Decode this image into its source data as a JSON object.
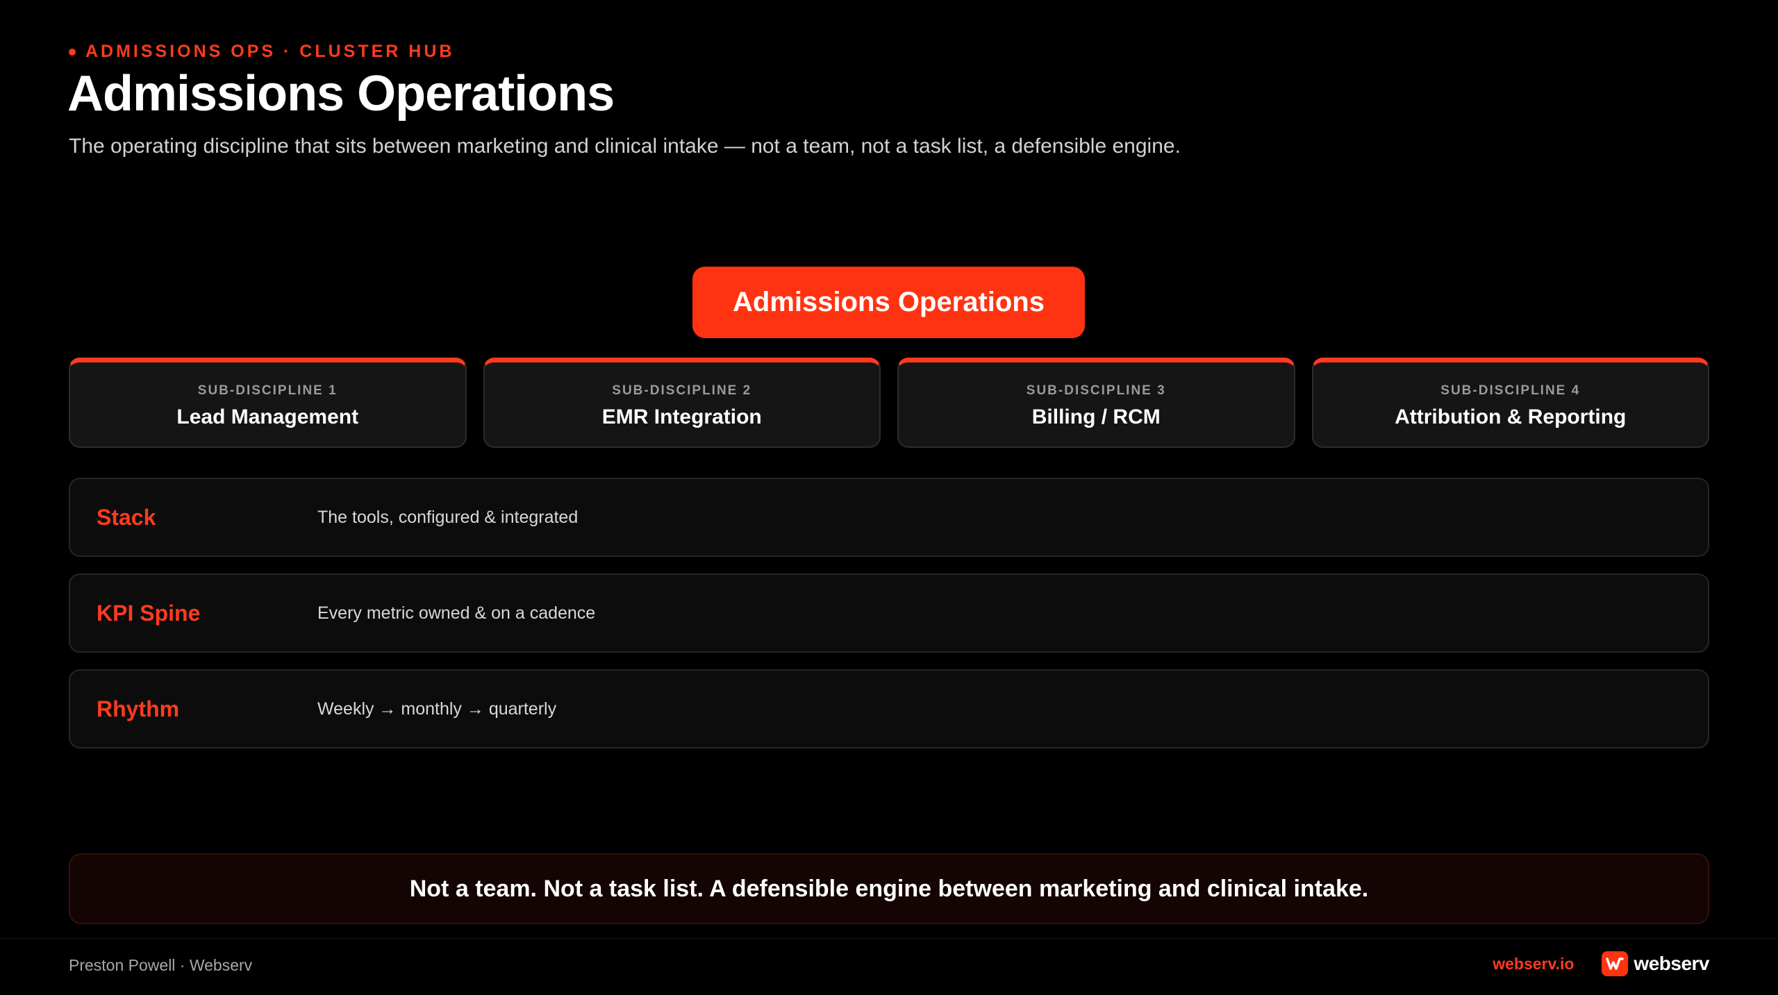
{
  "header": {
    "eyebrow": "ADMISSIONS OPS · CLUSTER HUB",
    "title": "Admissions Operations",
    "subtitle": "The operating discipline that sits between marketing and clinical intake — not a team, not a task list, a defensible engine."
  },
  "diagram": {
    "root": "Admissions Operations",
    "sub_disciplines": [
      {
        "kicker": "SUB-DISCIPLINE 1",
        "name": "Lead Management"
      },
      {
        "kicker": "SUB-DISCIPLINE 2",
        "name": "EMR Integration"
      },
      {
        "kicker": "SUB-DISCIPLINE 3",
        "name": "Billing / RCM"
      },
      {
        "kicker": "SUB-DISCIPLINE 4",
        "name": "Attribution & Reporting"
      }
    ],
    "layers": [
      {
        "label": "Stack",
        "description": "The tools, configured & integrated"
      },
      {
        "label": "KPI Spine",
        "description": "Every metric owned & on a cadence"
      },
      {
        "label": "Rhythm",
        "description": "Weekly → monthly → quarterly"
      }
    ]
  },
  "callout": "Not a team. Not a task list. A defensible engine between marketing and clinical intake.",
  "footer": {
    "author": "Preston Powell · Webserv",
    "link": "webserv.io",
    "brand": "webserv"
  },
  "colors": {
    "accent": "#ff3311",
    "background": "#000000",
    "card": "#151515"
  },
  "icons": {
    "eyebrow_marker": "dot-icon",
    "brand_mark": "webserv-logo-icon"
  }
}
